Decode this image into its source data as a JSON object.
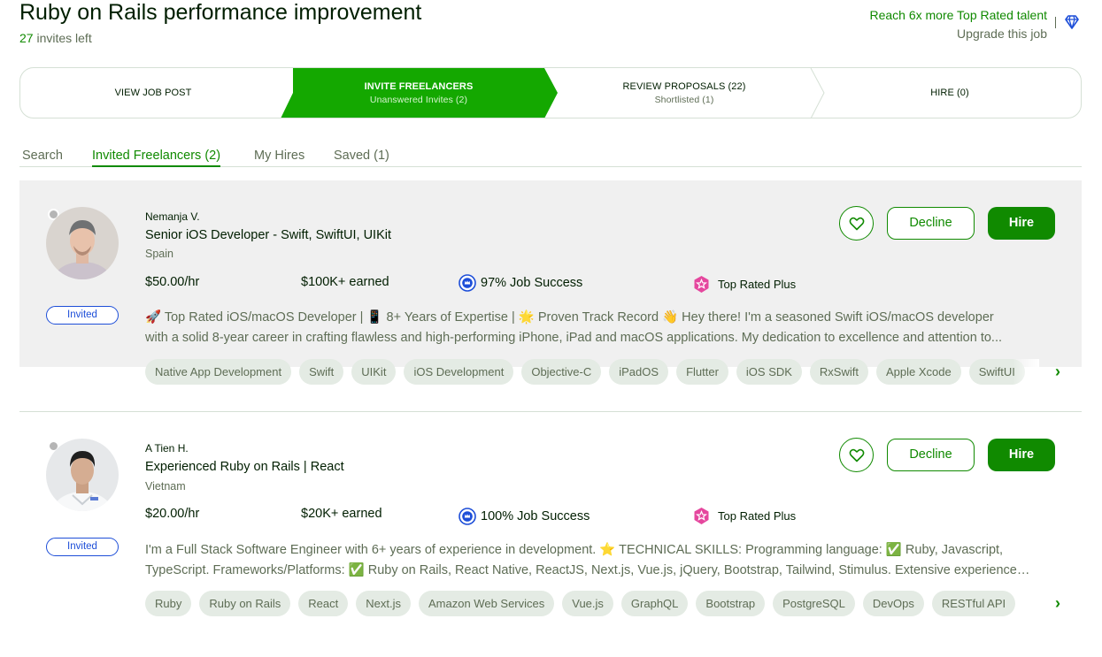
{
  "header": {
    "title": "Ruby on Rails performance improvement",
    "invites_count": "27",
    "invites_suffix": " invites left",
    "reach_text": "Reach 6x more Top Rated talent",
    "upgrade_text": "Upgrade this job"
  },
  "stepper": {
    "steps": [
      {
        "title": "VIEW JOB POST",
        "sub": ""
      },
      {
        "title": "INVITE FREELANCERS",
        "sub": "Unanswered Invites (2)"
      },
      {
        "title": "REVIEW PROPOSALS (22)",
        "sub": "Shortlisted (1)"
      },
      {
        "title": "HIRE (0)",
        "sub": ""
      }
    ],
    "active_color": "#14a800"
  },
  "tabs": [
    {
      "label": "Search"
    },
    {
      "label": "Invited Freelancers (2)"
    },
    {
      "label": "My Hires"
    },
    {
      "label": "Saved (1)"
    }
  ],
  "freelancers": [
    {
      "name": "Nemanja V.",
      "title": "Senior iOS Developer - Swift, SwiftUI, UIKit",
      "country": "Spain",
      "rate": "$50.00/hr",
      "earned": "$100K+ earned",
      "job_success": "97% Job Success",
      "badge": "Top Rated Plus",
      "status": "Invited",
      "description_lines": [
        "🚀 Top Rated iOS/macOS Developer | 📱 8+ Years of Expertise | 🌟 Proven Track Record 👋 Hey there! I'm a seasoned Swift iOS/macOS developer",
        "with a solid 8-year career in crafting flawless and high-performing iPhone, iPad and macOS applications. My dedication to excellence and attention to..."
      ],
      "skills": [
        "Native App Development",
        "Swift",
        "UIKit",
        "iOS Development",
        "Objective-C",
        "iPadOS",
        "Flutter",
        "iOS SDK",
        "RxSwift",
        "Apple Xcode",
        "SwiftUI"
      ],
      "actions": {
        "decline": "Decline",
        "hire": "Hire"
      }
    },
    {
      "name": "A Tien H.",
      "title": "Experienced Ruby on Rails | React",
      "country": "Vietnam",
      "rate": "$20.00/hr",
      "earned": "$20K+ earned",
      "job_success": "100% Job Success",
      "badge": "Top Rated Plus",
      "status": "Invited",
      "description_lines": [
        "I'm a Full Stack Software Engineer with 6+ years of experience in development. ⭐ TECHNICAL SKILLS: Programming language: ✅ Ruby, Javascript,",
        "TypeScript. Frameworks/Platforms: ✅ Ruby on Rails, React Native, ReactJS, Next.js, Vue.js, jQuery, Bootstrap, Tailwind, Stimulus. Extensive experience in..."
      ],
      "skills": [
        "Ruby",
        "Ruby on Rails",
        "React",
        "Next.js",
        "Amazon Web Services",
        "Vue.js",
        "GraphQL",
        "Bootstrap",
        "PostgreSQL",
        "DevOps",
        "RESTful API"
      ],
      "actions": {
        "decline": "Decline",
        "hire": "Hire"
      }
    }
  ],
  "colors": {
    "brand_green": "#108a00",
    "invited_blue": "#1d4ed8",
    "top_rated_pink": "#e5479e"
  },
  "icons": [
    "diamond-icon",
    "heart-icon",
    "job-success-icon",
    "top-rated-plus-icon",
    "chevron-right-icon"
  ]
}
